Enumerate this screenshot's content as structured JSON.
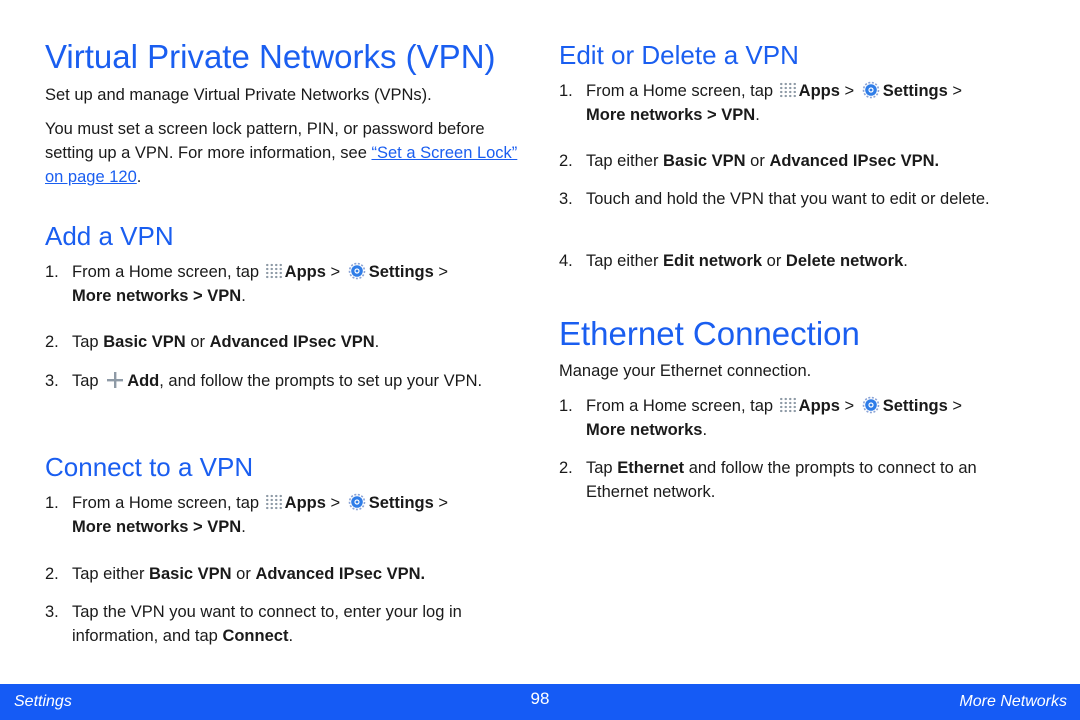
{
  "colors": {
    "accent": "#1a5ef0",
    "footer_bg": "#155bf5",
    "text": "#1a1a1a"
  },
  "vpn": {
    "title": "Virtual Private Networks (VPN)",
    "intro": "Set up and manage Virtual Private Networks (VPNs).",
    "lock_note": "You must set a screen lock pattern, PIN, or password before setting up a VPN. For more information, see ",
    "lock_link": "“Set a Screen Lock” on page 120",
    "lock_end": "."
  },
  "common": {
    "step1_prefix": "From a Home screen, tap ",
    "apps": "Apps",
    "sep": " > ",
    "settings": "Settings",
    "more_networks": "More networks",
    "vpn": "VPN",
    "period": ".",
    "apps_icon": "apps-grid-icon",
    "settings_icon": "gear-icon"
  },
  "add_vpn": {
    "heading": "Add a VPN",
    "step2_a": "Tap ",
    "step2_b": "Basic VPN",
    "step2_c": " or ",
    "step2_d": "Advanced IPsec VPN",
    "step2_e": ".",
    "step3_a": "Tap ",
    "step3_b": "Add",
    "step3_c": ", and follow the prompts to set up your VPN.",
    "add_icon": "plus-icon"
  },
  "connect_vpn": {
    "heading": "Connect to a VPN",
    "step2_a": "Tap either ",
    "step2_b": "Basic VPN",
    "step2_c": " or ",
    "step2_d": "Advanced IPsec VPN.",
    "step3_a": "Tap the VPN you want to connect to, enter your log in information, and tap ",
    "step3_b": "Connect",
    "step3_c": "."
  },
  "edit_vpn": {
    "heading": "Edit or Delete a VPN",
    "step2_a": "Tap either ",
    "step2_b": "Basic VPN",
    "step2_c": " or ",
    "step2_d": "Advanced IPsec VPN.",
    "step3": "Touch and hold the VPN that you want to edit or delete.",
    "step4_a": "Tap either ",
    "step4_b": "Edit network",
    "step4_c": " or ",
    "step4_d": "Delete network",
    "step4_e": "."
  },
  "ethernet": {
    "heading": "Ethernet Connection",
    "intro": "Manage your Ethernet connection.",
    "step2_a": "Tap ",
    "step2_b": "Ethernet",
    "step2_c": " and follow the prompts to connect to an Ethernet network."
  },
  "numbers": [
    "1.",
    "2.",
    "3.",
    "4."
  ],
  "footer": {
    "section": "Settings",
    "page": "98",
    "chapter": "More Networks"
  }
}
